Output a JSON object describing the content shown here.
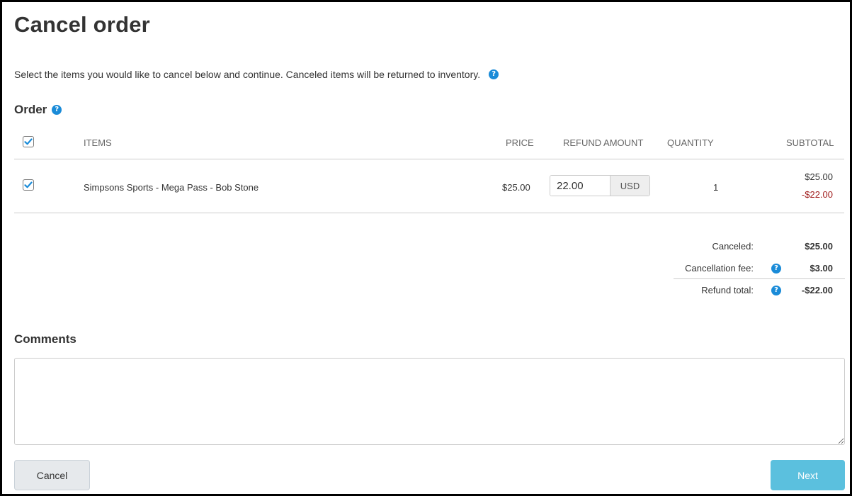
{
  "page": {
    "title": "Cancel order",
    "intro": "Select the items you would like to cancel below and continue. Canceled items will be returned to inventory."
  },
  "order": {
    "section_title": "Order",
    "headers": {
      "items": "ITEMS",
      "price": "PRICE",
      "refund_amount": "REFUND AMOUNT",
      "quantity": "QUANTITY",
      "subtotal": "SUBTOTAL"
    },
    "select_all_checked": true,
    "rows": [
      {
        "checked": true,
        "item": "Simpsons Sports - Mega Pass - Bob Stone",
        "price": "$25.00",
        "refund_value": "22.00",
        "refund_currency": "USD",
        "quantity": "1",
        "subtotal": "$25.00",
        "subtotal_refund": "-$22.00"
      }
    ]
  },
  "summary": {
    "canceled_label": "Canceled:",
    "canceled_value": "$25.00",
    "fee_label": "Cancellation fee:",
    "fee_value": "$3.00",
    "refund_total_label": "Refund total:",
    "refund_total_value": "-$22.00"
  },
  "comments": {
    "title": "Comments",
    "value": ""
  },
  "buttons": {
    "cancel": "Cancel",
    "next": "Next"
  },
  "colors": {
    "accent": "#1a8bd8",
    "negative": "#a01c1c",
    "next_button": "#5bc0de"
  },
  "icons": {
    "help": "question-circle",
    "check": "checkmark"
  }
}
